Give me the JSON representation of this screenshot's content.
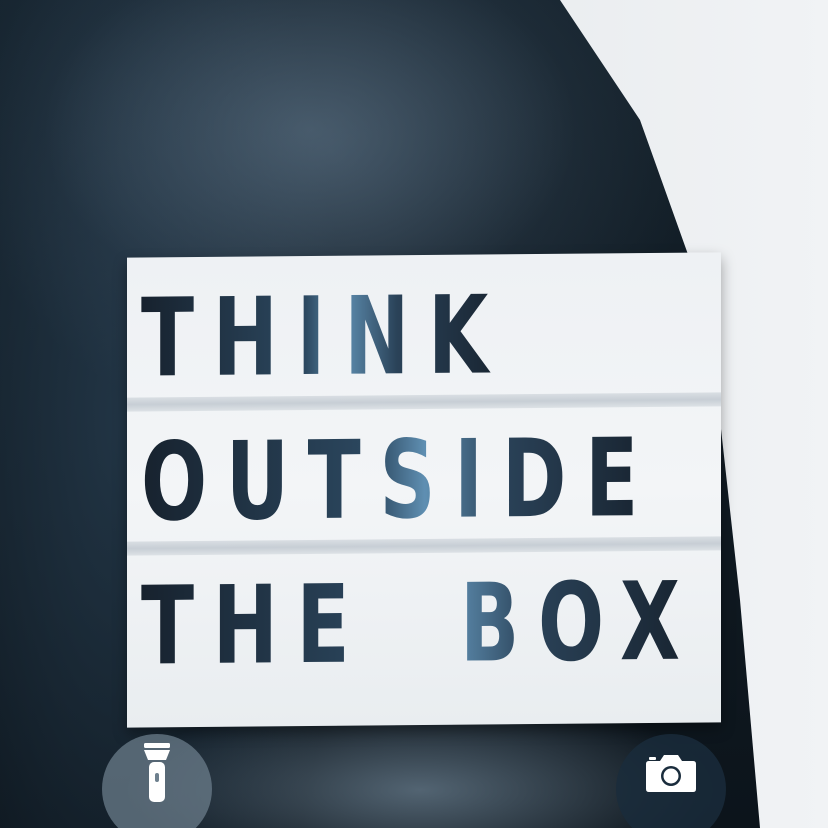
{
  "wallpaper": {
    "sign_lines": [
      "THINK",
      "OUTSIDE",
      "THE  BOX"
    ]
  },
  "controls": {
    "flashlight_icon": "flashlight-icon",
    "camera_icon": "camera-icon"
  },
  "colors": {
    "sign_letters": "#1e2c3a",
    "sign_panel": "#eef1f4",
    "button_bg": "#6e808e"
  }
}
